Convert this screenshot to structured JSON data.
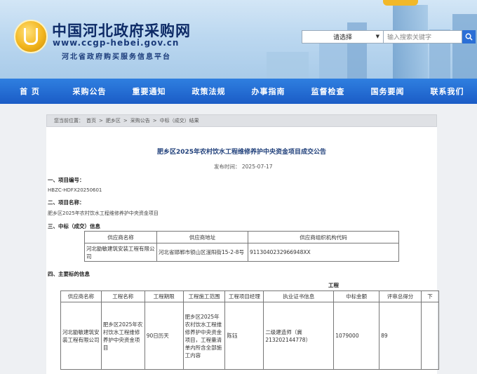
{
  "header": {
    "site_title": "中国河北政府采购网",
    "site_url": "www.ccgp-hebei.gov.cn",
    "site_sub": "河北省政府购买服务信息平台",
    "search_select": "请选择",
    "search_placeholder": "输入搜索关键字"
  },
  "nav": {
    "items": [
      "首 页",
      "采购公告",
      "重要通知",
      "政策法规",
      "办事指南",
      "监督检查",
      "国务要闻",
      "联系我们"
    ]
  },
  "breadcrumb": {
    "label": "您当前位置：",
    "items": [
      "首页",
      "肥乡区",
      "采购公告",
      "中标（成交）结果"
    ],
    "sep": ">"
  },
  "notice": {
    "title": "肥乡区2025年农村饮水工程维修养护中央资金项目成交公告",
    "pubdate": "发布时间： 2025-07-17",
    "sec1": "一、项目编号：",
    "project_no": "HBZC-HDFX20250601",
    "sec2": "二、项目名称：",
    "project_name": "肥乡区2025年农村饮水工程维修养护中央资金项目",
    "sec3": "三、中标（成交）信息",
    "sec4": "四、主要标的信息",
    "sec4_extra": "工程"
  },
  "supplier_table": {
    "headers": [
      "供应商名称",
      "供应商地址",
      "供应商组织机构代码"
    ],
    "row": [
      "河北勖敏建筑安装工程有限公司",
      "河北省邯郸市锁山区滏阳街15-2-8号",
      "91130402329669​48XX"
    ]
  },
  "item_table": {
    "headers": [
      "供应商名称",
      "工程名称",
      "工程期限",
      "工程施工范围",
      "工程项目经理",
      "执业证书信息",
      "中标金额",
      "评审总得分",
      "下"
    ],
    "row": [
      "河北勖敏建筑安装工程有限公司",
      "肥乡区2025年农村饮水工程维修养护中央资金项目",
      "90日历天",
      "肥乡区2025年农村饮水工程维修养护中央资金项目，工程量清单内所含全部施工内容",
      "陈钰",
      "二级建造师（冀213202144778）",
      "1079000",
      "89",
      ""
    ]
  },
  "colors": {
    "nav_blue": "#1b5cc6",
    "title_navy": "#0d2a66",
    "search_button": "#2b6fd6"
  }
}
